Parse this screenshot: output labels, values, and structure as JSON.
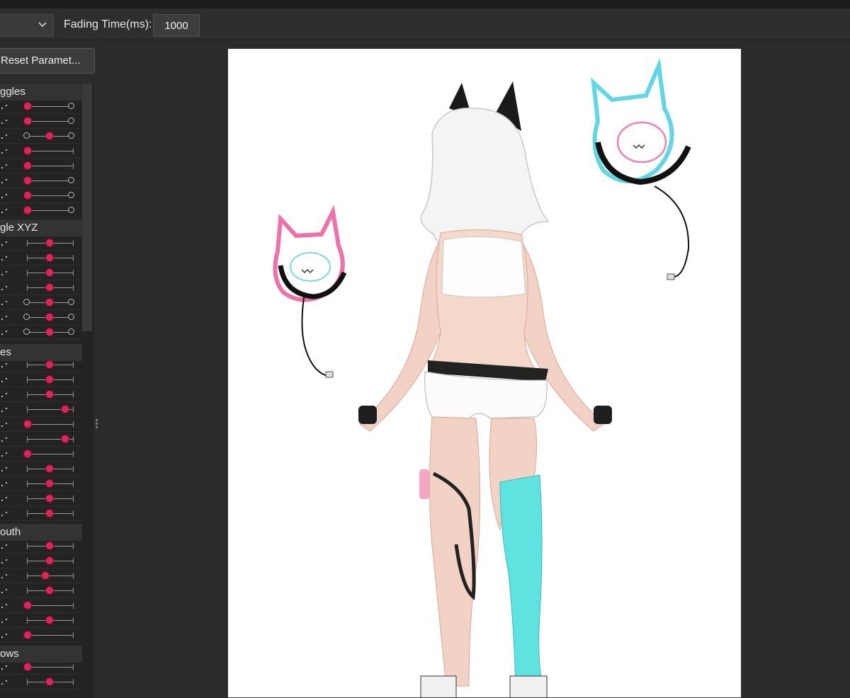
{
  "toolbar": {
    "fading_label": "Fading Time(ms):",
    "fading_value": "1000"
  },
  "reset_button": "Reset Paramet...",
  "groups": [
    {
      "label": "ggles",
      "sliders": [
        0.0,
        0.0,
        0.5,
        0.0,
        0.0,
        0.0,
        0.0,
        0.0
      ]
    },
    {
      "label": "gle XYZ",
      "sliders": [
        0.5,
        0.5,
        0.5,
        0.5,
        0.5,
        0.5,
        0.5
      ]
    },
    {
      "label": "es",
      "sliders": [
        0.5,
        0.5,
        0.5,
        0.85,
        0.0,
        0.85,
        0.0,
        0.5,
        0.5,
        0.5,
        0.5
      ]
    },
    {
      "label": "outh",
      "sliders": [
        0.5,
        0.5,
        0.4,
        0.5,
        0.0,
        0.5,
        0.0
      ]
    },
    {
      "label": "ows",
      "sliders": [
        0.0,
        0.5
      ]
    }
  ],
  "colors": {
    "accent": "#e0245a",
    "panel_bg": "#232323",
    "app_bg": "#2b2b2b"
  }
}
